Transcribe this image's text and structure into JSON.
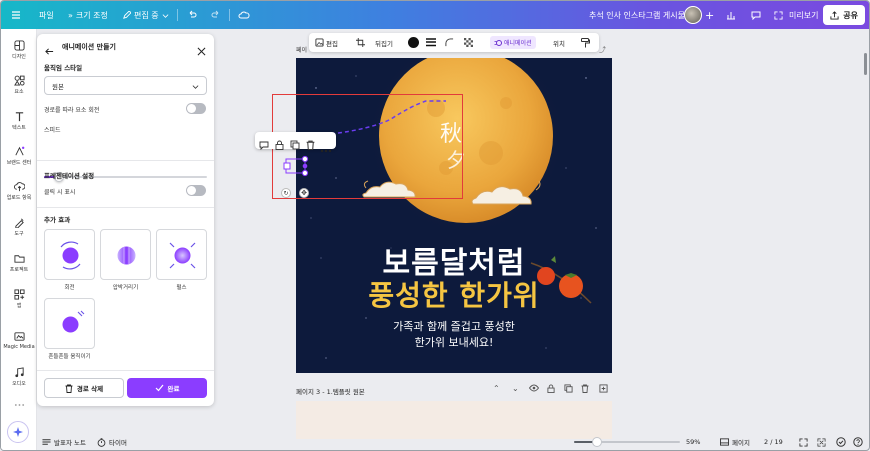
{
  "topbar": {
    "file_label": "파일",
    "resize_label": "크기 조정",
    "editing_label": "편집 중",
    "doc_title": "추석 인사 인스타그램 게시물",
    "preview_label": "미리보기",
    "share_label": "공유"
  },
  "rail": {
    "items": [
      {
        "label": "디자인",
        "icon": "design-icon"
      },
      {
        "label": "요소",
        "icon": "elements-icon"
      },
      {
        "label": "텍스트",
        "icon": "text-icon"
      },
      {
        "label": "브랜드 센터",
        "icon": "brand-icon"
      },
      {
        "label": "업로드 항목",
        "icon": "upload-icon"
      },
      {
        "label": "도구",
        "icon": "tools-icon"
      },
      {
        "label": "프로젝트",
        "icon": "folder-icon"
      },
      {
        "label": "앱",
        "icon": "apps-icon"
      },
      {
        "label": "Magic Media",
        "icon": "magic-media-icon"
      },
      {
        "label": "오디오",
        "icon": "music-icon"
      }
    ]
  },
  "panel": {
    "title": "애니메이션 만들기",
    "motion_style_label": "움직임 스타일",
    "motion_style_value": "원본",
    "rotate_along_path_label": "경로를 따라 요소 회전",
    "speed_label": "스피드",
    "speed_value": 0.09,
    "presentation_settings_label": "프레젠테이션 설정",
    "show_on_click_label": "클릭 시 표시",
    "additional_effects_label": "추가 효과",
    "effects": [
      {
        "label": "회전"
      },
      {
        "label": "압박거리기"
      },
      {
        "label": "펄스"
      },
      {
        "label": "흔들흔들 움직이기"
      }
    ],
    "delete_path_label": "경로 삭제",
    "done_label": "완료"
  },
  "toolbar": {
    "edit_label": "편집",
    "flip_label": "뒤집기",
    "animation_label": "애니메이션",
    "position_label": "위치"
  },
  "canvas": {
    "page_label_small": "페이",
    "headline": "보름달처럼",
    "subline": "풍성한 한가위",
    "message_line1": "가족과 함께 즐겁고 풍성한",
    "message_line2": "한가위 보내세요!",
    "moon_chars": [
      "秋",
      "夕"
    ],
    "page3_label": "페이지 3 - 1.템플릿 원본"
  },
  "bottombar": {
    "notes_label": "발표자 노트",
    "timer_label": "타이머",
    "zoom_percent": "59%",
    "zoom_value": 0.22,
    "pages_label": "페이지",
    "page_counter": "2 / 19"
  },
  "colors": {
    "accent": "#8b3dff",
    "headline_white": "#ffffff",
    "subline_yellow": "#f5c542",
    "night_sky": "#0d1a3c",
    "moon": "#f1b448"
  }
}
